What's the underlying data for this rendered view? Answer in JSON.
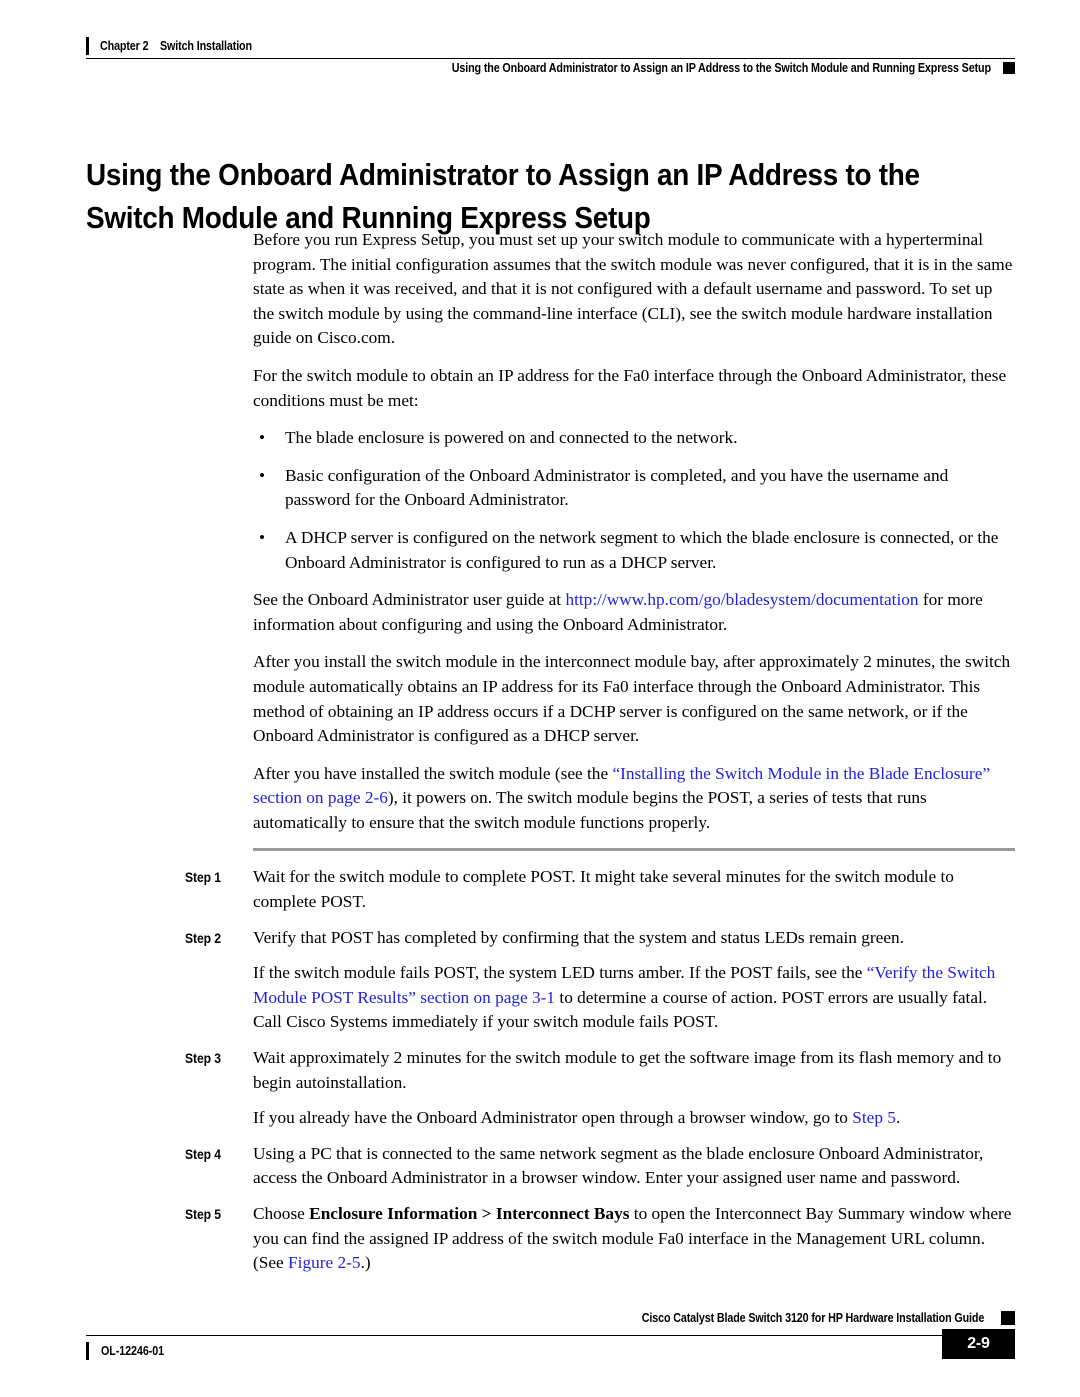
{
  "header": {
    "chapter_label": "Chapter 2",
    "chapter_title": "Switch Installation",
    "section_title": "Using the Onboard Administrator to Assign an IP Address to the Switch Module and Running Express Setup"
  },
  "heading": "Using the Onboard Administrator to Assign an IP Address to the Switch Module and Running Express Setup",
  "body": {
    "p1": "Before you run Express Setup, you must set up your switch module to communicate with a hyperterminal program. The initial configuration assumes that the switch module was never configured, that it is in the same state as when it was received, and that it is not configured with a default username and password. To set up the switch module by using the command-line interface (CLI), see the switch module hardware installation guide on Cisco.com.",
    "p2": "For the switch module to obtain an IP address for the Fa0 interface through the Onboard Administrator, these conditions must be met:",
    "bullet_symbol": "•",
    "bullets": [
      "The blade enclosure is powered on and connected to the network.",
      "Basic configuration of the Onboard Administrator is completed, and you have the username and password for the Onboard Administrator.",
      "A DHCP server is configured on the network segment to which the blade enclosure is connected, or the Onboard Administrator is configured to run as a DHCP server."
    ],
    "p3_before": "See the Onboard Administrator user guide at ",
    "p3_link": "http://www.hp.com/go/bladesystem/documentation",
    "p3_after": " for more information about configuring and using the Onboard Administrator.",
    "p4": "After you install the switch module in the interconnect module bay, after approximately 2 minutes, the switch module automatically obtains an IP address for its Fa0 interface through the Onboard Administrator. This method of obtaining an IP address occurs if a DCHP server is configured on the same network, or if the Onboard Administrator is configured as a DHCP server.",
    "p5_before": "After you have installed the switch module (see the ",
    "p5_link": "“Installing the Switch Module in the Blade Enclosure” section on page 2-6",
    "p5_after": "), it powers on. The switch module begins the POST, a series of tests that runs automatically to ensure that the switch module functions properly."
  },
  "steps": {
    "step1": {
      "label": "Step 1",
      "text": "Wait for the switch module to complete POST. It might take several minutes for the switch module to complete POST."
    },
    "step2": {
      "label": "Step 2",
      "text": "Verify that POST has completed by confirming that the system and status LEDs remain green."
    },
    "step2_note_before": "If the switch module fails POST, the system LED turns amber. If the POST fails, see the ",
    "step2_note_link": "“Verify the Switch Module POST Results” section on page 3-1",
    "step2_note_after": " to determine a course of action. POST errors are usually fatal. Call Cisco Systems immediately if your switch module fails POST.",
    "step3": {
      "label": "Step 3",
      "text": "Wait approximately 2 minutes for the switch module to get the software image from its flash memory and to begin autoinstallation."
    },
    "step3_note_before": "If you already have the Onboard Administrator open through a browser window, go to ",
    "step3_note_link": "Step 5",
    "step3_note_after": ".",
    "step4": {
      "label": "Step 4",
      "text": "Using a PC that is connected to the same network segment as the blade enclosure Onboard Administrator, access the Onboard Administrator in a browser window. Enter your assigned user name and password."
    },
    "step5": {
      "label": "Step 5",
      "text_before": "Choose ",
      "text_bold": "Enclosure Information > Interconnect Bays",
      "text_mid": " to open the Interconnect Bay Summary window where you can find the assigned IP address of the switch module Fa0 interface in the Management URL column. (See ",
      "text_link": "Figure 2-5",
      "text_after": ".)"
    }
  },
  "footer": {
    "guide_title": "Cisco Catalyst Blade Switch 3120 for HP Hardware Installation Guide",
    "doc_id": "OL-12246-01",
    "page_number": "2-9"
  },
  "colors": {
    "link": "#2222dd",
    "rule_gray": "#9a9a9a",
    "text": "#000000"
  }
}
